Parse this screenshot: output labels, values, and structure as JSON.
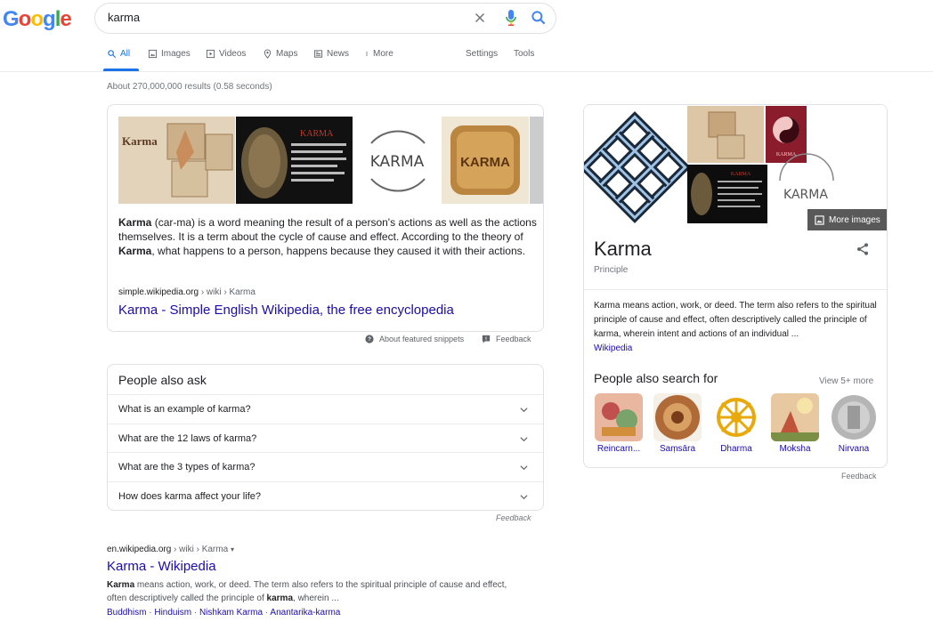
{
  "logo": {
    "text": "Google"
  },
  "search": {
    "query": "karma"
  },
  "tabs": [
    {
      "label": "All",
      "icon": "search-icon"
    },
    {
      "label": "Images",
      "icon": "image-icon"
    },
    {
      "label": "Videos",
      "icon": "video-icon"
    },
    {
      "label": "Maps",
      "icon": "map-pin-icon"
    },
    {
      "label": "News",
      "icon": "news-icon"
    },
    {
      "label": "More",
      "icon": "more-vertical-icon"
    },
    {
      "label": "Settings"
    },
    {
      "label": "Tools"
    }
  ],
  "stats": "About 270,000,000 results (0.58 seconds)",
  "snippet": {
    "images": [
      "Karma",
      "KARMA",
      "KARMA",
      "KARMA"
    ],
    "text_parts": [
      {
        "b": "Karma"
      },
      {
        "t": " (car-ma) is a word meaning the result of a person's actions as well as the actions themselves. It is a term about the cycle of cause and effect. According to the theory of "
      },
      {
        "b": "Karma"
      },
      {
        "t": ", what happens to a person, happens because they caused it with their actions."
      }
    ],
    "cite_domain": "simple.wikipedia.org",
    "cite_path": " › wiki › Karma",
    "link": "Karma - Simple English Wikipedia, the free encyclopedia",
    "about": "About featured snippets",
    "feedback": "Feedback"
  },
  "paa": {
    "title": "People also ask",
    "questions": [
      "What is an example of karma?",
      "What are the 12 laws of karma?",
      "What are the 3 types of karma?",
      "How does karma affect your life?"
    ],
    "feedback": "Feedback"
  },
  "wiki": {
    "cite_domain": "en.wikipedia.org",
    "cite_path": " › wiki › Karma",
    "title": "Karma - Wikipedia",
    "desc_b1": "Karma",
    "desc_t1": " means action, work, or deed. The term also refers to the spiritual principle of cause and effect, often descriptively called the principle of ",
    "desc_b2": "karma",
    "desc_t2": ", wherein ...",
    "links": [
      "Buddhism",
      "Hinduism",
      "Nishkam Karma",
      "Anantarika-karma"
    ]
  },
  "knowledge_panel": {
    "title": "Karma",
    "subtitle": "Principle",
    "more_images": "More images",
    "thumb_text": "KARMA",
    "desc": "Karma means action, work, or deed. The term also refers to the spiritual principle of cause and effect, often descriptively called the principle of karma, wherein intent and actions of an individual ...",
    "source": "Wikipedia",
    "pasf_title": "People also search for",
    "view_more": "View 5+ more",
    "pasf": [
      "Reincarn...",
      "Saṃsāra",
      "Dharma",
      "Moksha",
      "Nirvana"
    ],
    "feedback": "Feedback"
  },
  "colors": {
    "link": "#1a0dab",
    "accent": "#1a73e8",
    "muted": "#70757a"
  }
}
